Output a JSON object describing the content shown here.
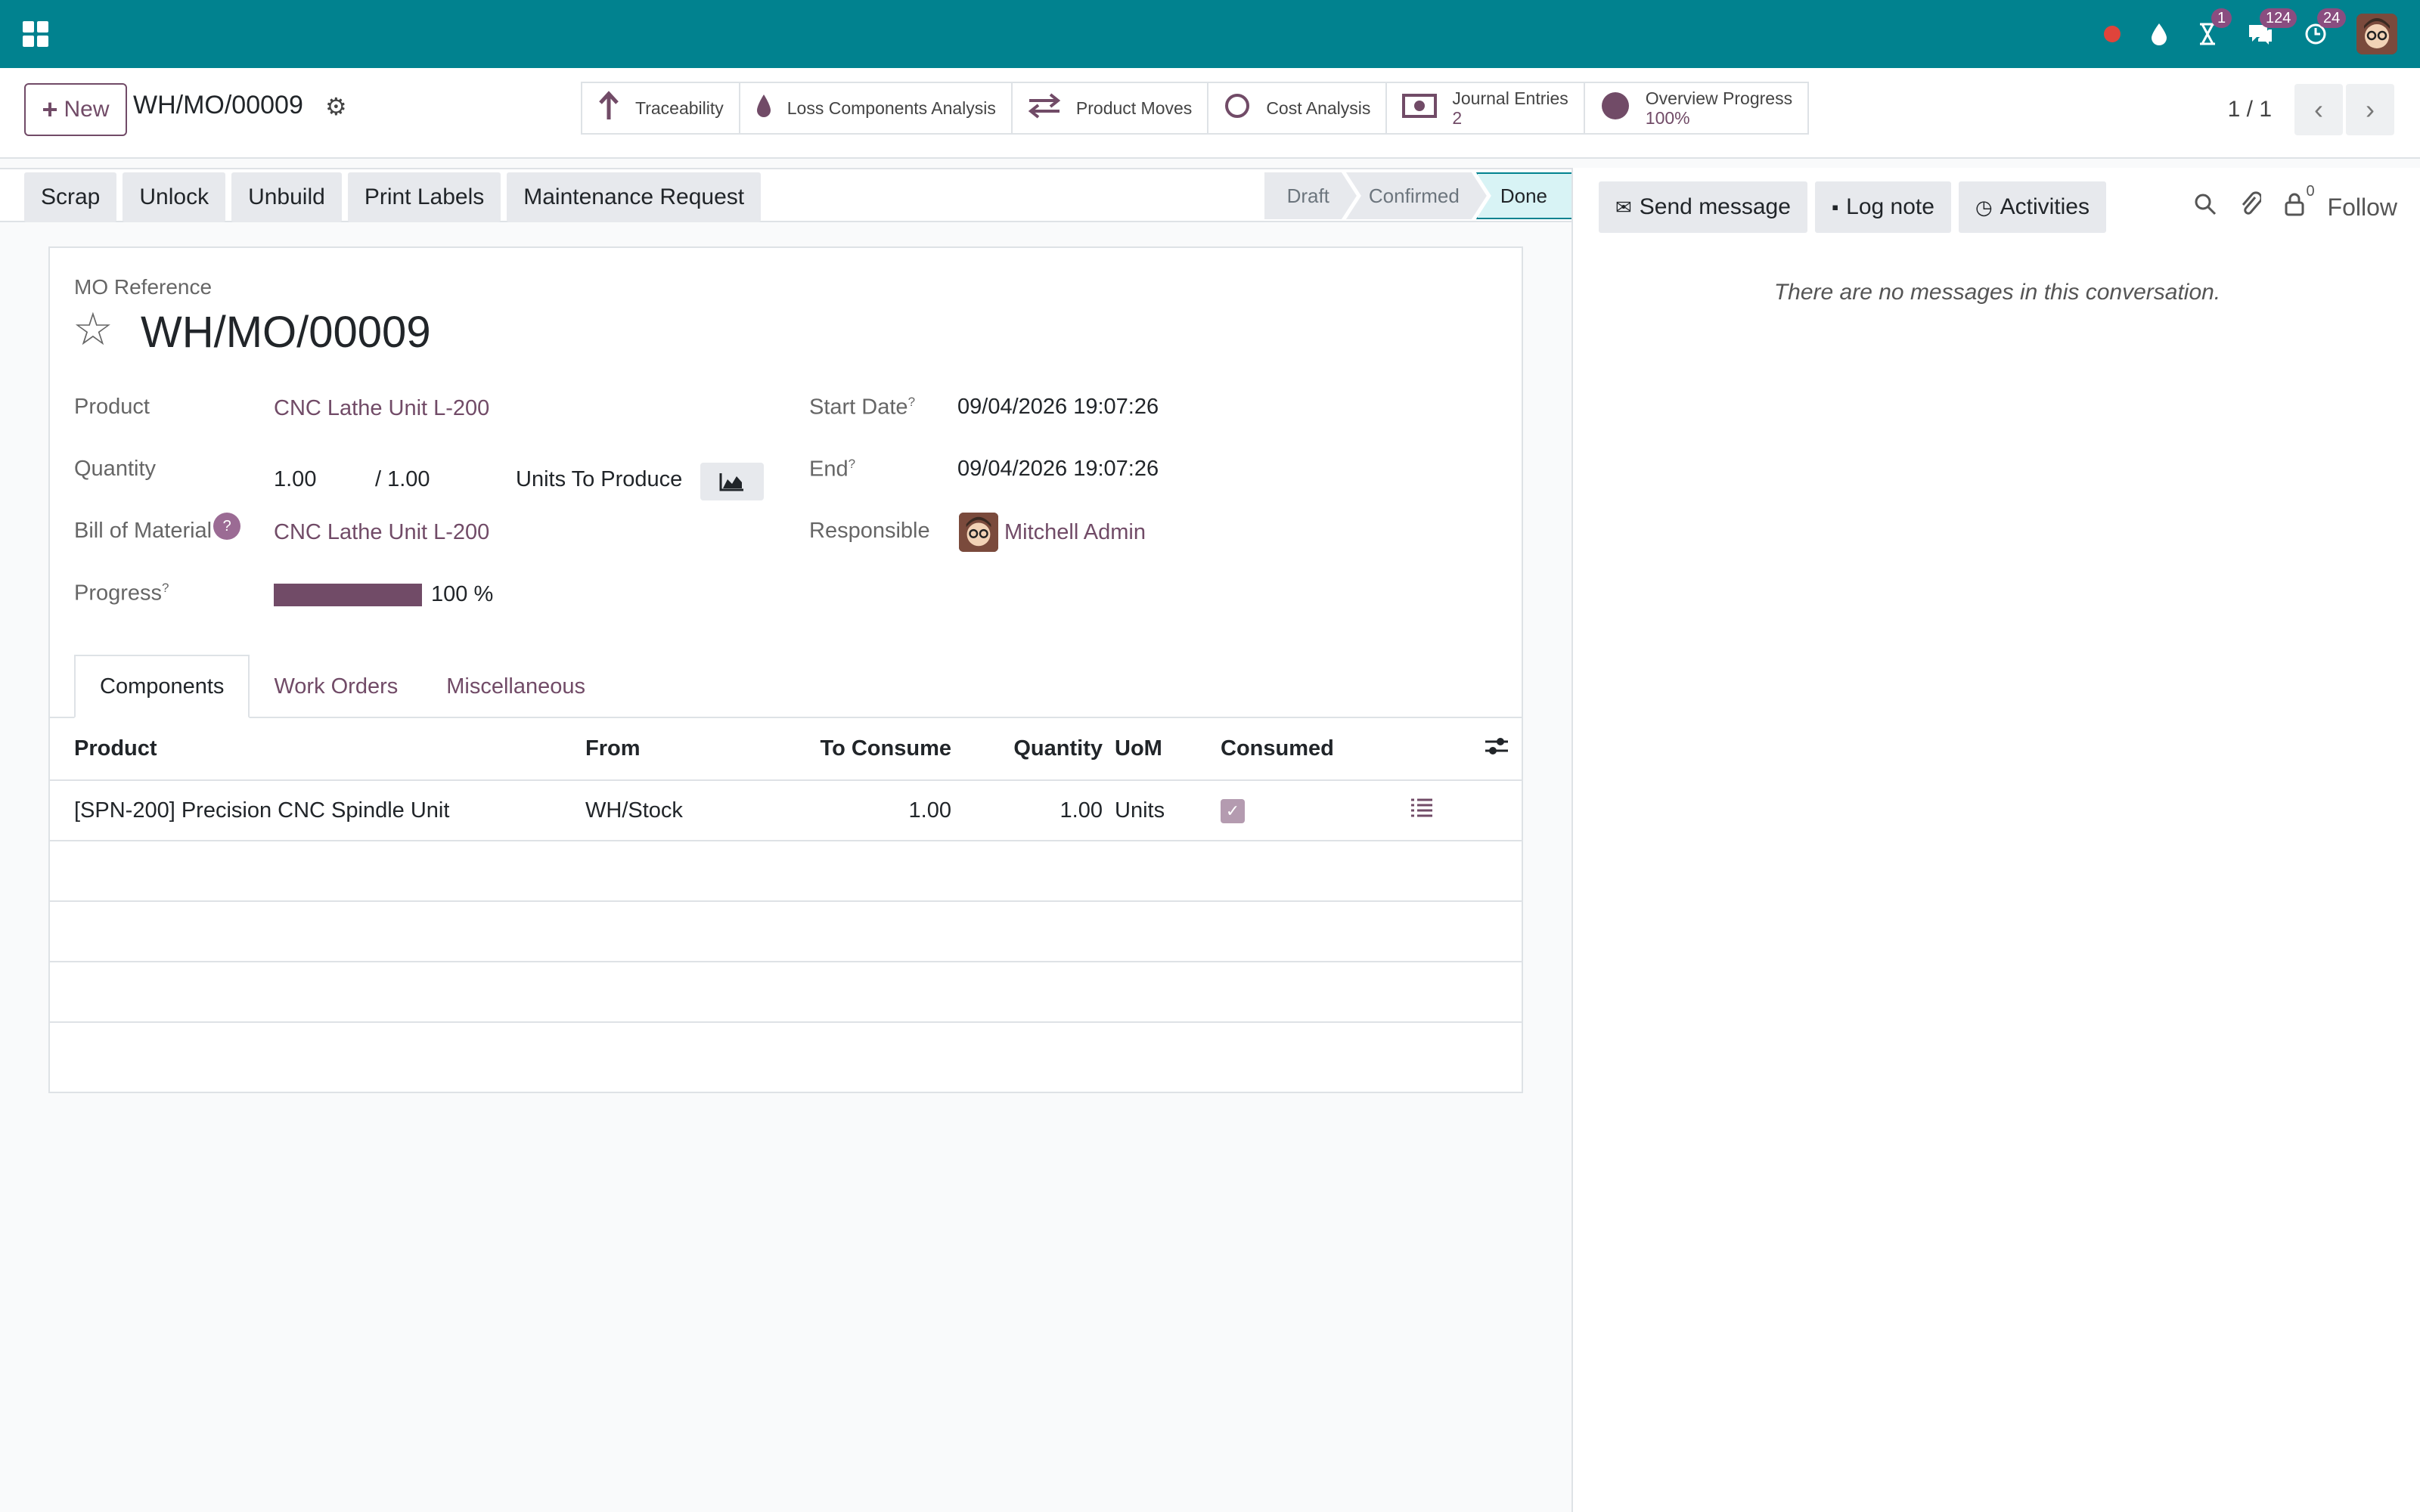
{
  "topbar": {
    "badges": {
      "activities": "1",
      "messages": "124",
      "updates": "24"
    }
  },
  "control": {
    "new_label": "New",
    "record_title": "WH/MO/00009",
    "smart_buttons": [
      {
        "label": "Traceability",
        "icon": "arrow-up-icon"
      },
      {
        "label": "Loss Components Analysis",
        "icon": "drop-icon"
      },
      {
        "label": "Product Moves",
        "icon": "exchange-icon"
      },
      {
        "label": "Cost Analysis",
        "icon": "circle-icon"
      },
      {
        "label": "Journal Entries",
        "value": "2",
        "icon": "money-icon"
      },
      {
        "label": "Overview Progress",
        "value": "100%",
        "icon": "pie-icon"
      }
    ],
    "pager": "1 / 1"
  },
  "actions": [
    "Scrap",
    "Unlock",
    "Unbuild",
    "Print Labels",
    "Maintenance Request"
  ],
  "stages": [
    "Draft",
    "Confirmed",
    "Done"
  ],
  "form": {
    "ref_label": "MO Reference",
    "ref_value": "WH/MO/00009",
    "product_label": "Product",
    "product_value": "CNC Lathe Unit L-200",
    "quantity_label": "Quantity",
    "quantity_value": "1.00",
    "quantity_target": "/ 1.00",
    "quantity_uom": "Units To Produce",
    "bom_label": "Bill of Material",
    "bom_value": "CNC Lathe Unit L-200",
    "progress_label": "Progress",
    "progress_value": "100 %",
    "progress_fraction": 1.0,
    "start_label": "Start Date",
    "start_value": "09/04/2026 19:07:26",
    "end_label": "End",
    "end_value": "09/04/2026 19:07:26",
    "responsible_label": "Responsible",
    "responsible_value": "Mitchell Admin",
    "help_mark": "?"
  },
  "tabs": [
    "Components",
    "Work Orders",
    "Miscellaneous"
  ],
  "components": {
    "headers": [
      "Product",
      "From",
      "To Consume",
      "Quantity",
      "UoM",
      "Consumed"
    ],
    "rows": [
      {
        "product": "[SPN-200] Precision CNC Spindle Unit",
        "from": "WH/Stock",
        "to_consume": "1.00",
        "quantity": "1.00",
        "uom": "Units",
        "consumed": true
      }
    ]
  },
  "chatter": {
    "send_message": "Send message",
    "log_note": "Log note",
    "activities": "Activities",
    "followers_count": "0",
    "follow": "Follow",
    "empty": "There are no messages in this conversation."
  }
}
